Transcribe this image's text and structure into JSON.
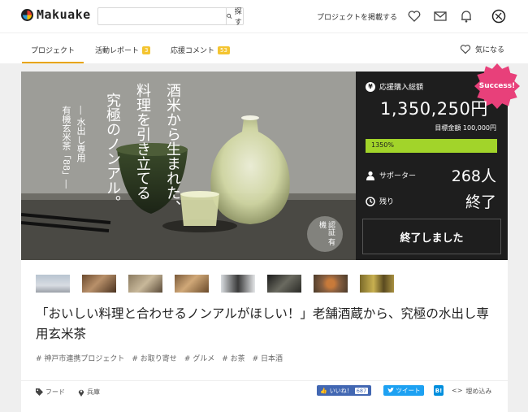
{
  "header": {
    "brand": "Makuake",
    "search_placeholder": "",
    "search_button": "探す",
    "post_project": "プロジェクトを掲載する"
  },
  "tabs": {
    "project": "プロジェクト",
    "activity": "活動レポート",
    "activity_count": "3",
    "comments": "応援コメント",
    "comments_count": "53",
    "favorite": "気になる"
  },
  "hero": {
    "catch_line1": "酒米から生まれた、",
    "catch_line2": "料理を引き立てる",
    "catch_line3": "究極のノンアル。",
    "sub_line1": "― 水出し専用",
    "sub_line2": "有機玄米茶「88」―",
    "cert_label": "認証 有機"
  },
  "panel": {
    "success_badge": "Success!",
    "raised_label": "応援購入総額",
    "raised_amount": "1,350,250円",
    "goal_text": "目標金額 100,000円",
    "progress_label": "1350%",
    "progress_fill_fraction": 1.0,
    "supporters_label": "サポーター",
    "supporters_value": "268人",
    "remaining_label": "残り",
    "remaining_value": "終了",
    "ended_button": "終了しました"
  },
  "thumbnails_count": 8,
  "project": {
    "title": "「おいしい料理と合わせるノンアルがほしい！」老舗酒蔵から、究極の水出し専用玄米茶",
    "tags": [
      "# 神戸市連携プロジェクト",
      "# お取り寄せ",
      "# グルメ",
      "# お茶",
      "# 日本酒"
    ]
  },
  "footer": {
    "category": "フード",
    "location": "兵庫",
    "like_label": "いいね！",
    "like_count": "687",
    "tweet_label": "ツイート",
    "hatena_label": "B!",
    "embed_label": "埋め込み"
  },
  "colors": {
    "accent": "#e8a400",
    "progress": "#a2d42a",
    "panel_bg": "#1e1e1e",
    "success": "#e8407a",
    "facebook": "#4267b2",
    "twitter": "#1da1f2"
  }
}
